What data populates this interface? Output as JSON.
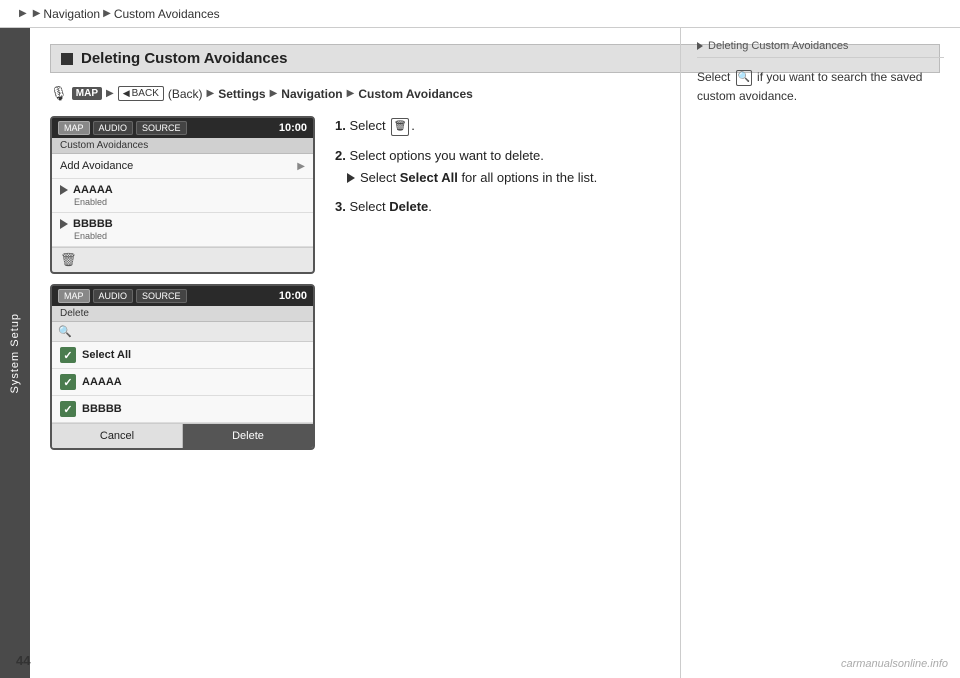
{
  "topBar": {
    "breadcrumb": [
      "Navigation",
      "Custom Avoidances"
    ]
  },
  "sidebar": {
    "label": "System Setup"
  },
  "pageNumber": "44",
  "sectionHeading": "Deleting Custom Avoidances",
  "navPath": {
    "iconLabel": "voice-icon",
    "mapBadge": "MAP",
    "backBadge": "BACK",
    "backText": "(Back)",
    "steps": [
      "Settings",
      "Navigation",
      "Custom Avoidances"
    ]
  },
  "screen1": {
    "tabs": [
      "MAP",
      "AUDIO",
      "SOURCE"
    ],
    "time": "10:00",
    "titleBar": "Custom Avoidances",
    "menuItems": [
      {
        "label": "Add Avoidance",
        "hasArrow": true
      },
      {
        "name": "AAAAA",
        "status": "Enabled"
      },
      {
        "name": "BBBBB",
        "status": "Enabled"
      }
    ]
  },
  "screen2": {
    "tabs": [
      "MAP",
      "AUDIO",
      "SOURCE"
    ],
    "time": "10:00",
    "deleteLabel": "Delete",
    "checkItems": [
      "Select All",
      "AAAAA",
      "BBBBB"
    ],
    "cancelBtn": "Cancel",
    "deleteBtn": "Delete"
  },
  "instructions": {
    "step1": {
      "number": "1.",
      "text": "Select",
      "iconSymbol": "🗑"
    },
    "step2": {
      "number": "2.",
      "mainText": "Select options you want to delete.",
      "subText": "Select",
      "subBold": "Select All",
      "subTextEnd": "for all options in the list."
    },
    "step3": {
      "number": "3.",
      "text": "Select",
      "boldText": "Delete",
      "period": "."
    }
  },
  "rightPanel": {
    "title": "Deleting Custom Avoidances",
    "bodyText1": "Select",
    "bodyIcon": "🔍",
    "bodyText2": "if you want to search the saved custom avoidance."
  },
  "watermark": "carmanualsonline.info"
}
